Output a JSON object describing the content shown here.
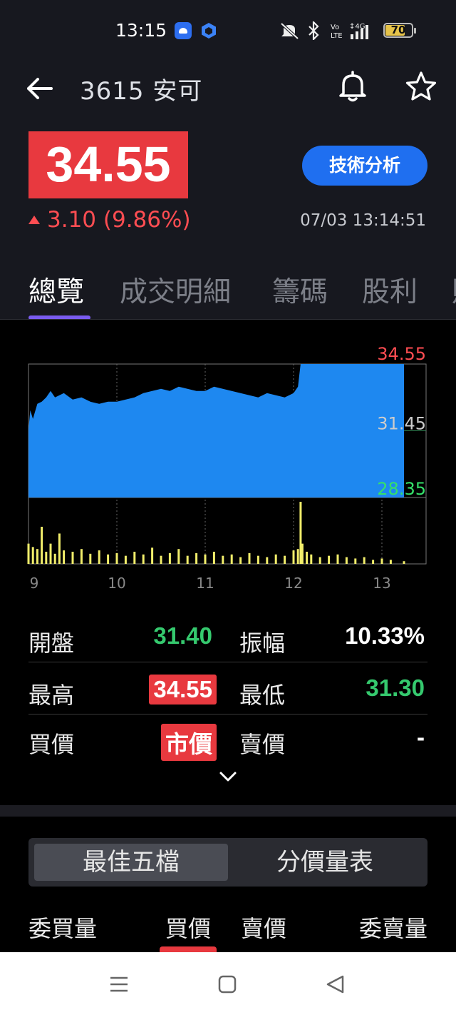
{
  "status_bar": {
    "time": "13:15",
    "icons": [
      "android-app-icon",
      "hexagon-app-icon",
      "mute-icon",
      "bluetooth-icon",
      "volte-icon",
      "4g-signal-icon"
    ],
    "battery": "70",
    "battery_level": 0.7
  },
  "header": {
    "title": "3615 安可",
    "price": "34.55",
    "change": "3.10 (9.86%)",
    "timestamp": "07/03 13:14:51",
    "tech_button": "技術分析",
    "accent_color": "#1f6ff0",
    "up_color": "#e8393f"
  },
  "tabs": [
    {
      "label": "總覽",
      "active": true
    },
    {
      "label": "成交明細",
      "active": false
    },
    {
      "label": "籌碼",
      "active": false
    },
    {
      "label": "股利",
      "active": false
    },
    {
      "label": "財",
      "active": false
    }
  ],
  "chart_data": {
    "type": "area",
    "x_ticks": [
      "9",
      "10",
      "11",
      "12",
      "13"
    ],
    "y_labels": {
      "high": "34.55",
      "ref": "31.45",
      "low": "28.35"
    },
    "ylim": [
      28.35,
      34.55
    ],
    "price": {
      "x": [
        9.0,
        9.02,
        9.05,
        9.1,
        9.15,
        9.2,
        9.25,
        9.3,
        9.35,
        9.4,
        9.5,
        9.6,
        9.7,
        9.8,
        9.9,
        10.0,
        10.1,
        10.2,
        10.3,
        10.4,
        10.5,
        10.6,
        10.7,
        10.8,
        10.9,
        11.0,
        11.1,
        11.2,
        11.3,
        11.4,
        11.5,
        11.6,
        11.7,
        11.8,
        11.9,
        12.0,
        12.05,
        12.08,
        12.1,
        12.2,
        12.4,
        12.6,
        12.8,
        13.0,
        13.1,
        13.25
      ],
      "y": [
        31.5,
        32.4,
        32.0,
        32.7,
        32.8,
        33.0,
        33.3,
        33.0,
        33.1,
        33.2,
        32.9,
        33.0,
        32.8,
        32.7,
        32.8,
        32.8,
        32.9,
        33.0,
        33.2,
        33.3,
        33.4,
        33.3,
        33.5,
        33.4,
        33.3,
        33.3,
        33.5,
        33.4,
        33.3,
        33.2,
        33.1,
        33.0,
        33.2,
        33.1,
        33.0,
        33.2,
        33.5,
        34.55,
        34.55,
        34.55,
        34.55,
        34.55,
        34.55,
        34.55,
        34.55,
        34.55
      ]
    },
    "volume": {
      "x": [
        9.0,
        9.05,
        9.1,
        9.15,
        9.2,
        9.25,
        9.3,
        9.35,
        9.4,
        9.5,
        9.6,
        9.7,
        9.8,
        9.9,
        10.0,
        10.1,
        10.2,
        10.3,
        10.4,
        10.5,
        10.6,
        10.7,
        10.8,
        10.9,
        11.0,
        11.1,
        11.2,
        11.3,
        11.4,
        11.5,
        11.6,
        11.7,
        11.8,
        11.9,
        12.0,
        12.05,
        12.08,
        12.1,
        12.15,
        12.2,
        12.3,
        12.4,
        12.5,
        12.6,
        12.7,
        12.8,
        12.9,
        13.0,
        13.1,
        13.25
      ],
      "values": [
        30,
        25,
        22,
        55,
        18,
        30,
        15,
        45,
        20,
        18,
        22,
        15,
        20,
        14,
        16,
        12,
        18,
        14,
        24,
        12,
        16,
        22,
        12,
        16,
        14,
        18,
        12,
        14,
        10,
        16,
        12,
        10,
        14,
        12,
        20,
        22,
        92,
        30,
        18,
        14,
        10,
        12,
        14,
        10,
        8,
        10,
        6,
        8,
        6,
        4
      ]
    },
    "colors": {
      "area": "#1e88f0",
      "volume": "#f2ee6b",
      "high": "#ff4d52",
      "low": "#35e06a",
      "ref": "#cccccc"
    }
  },
  "stats": {
    "open_label": "開盤",
    "open": "31.40",
    "amp_label": "振幅",
    "amp": "10.33%",
    "high_label": "最高",
    "high": "34.55",
    "low_label": "最低",
    "low": "31.30",
    "bid_label": "買價",
    "bid": "市價",
    "ask_label": "賣價",
    "ask": "-"
  },
  "orderbook": {
    "seg_best5": "最佳五檔",
    "seg_volume": "分價量表",
    "bid_qty": "委買量",
    "bid_price": "買價",
    "ask_price": "賣價",
    "ask_qty": "委賣量"
  },
  "navbar": {
    "icons": [
      "menu-icon",
      "home-square-icon",
      "back-triangle-icon"
    ]
  }
}
